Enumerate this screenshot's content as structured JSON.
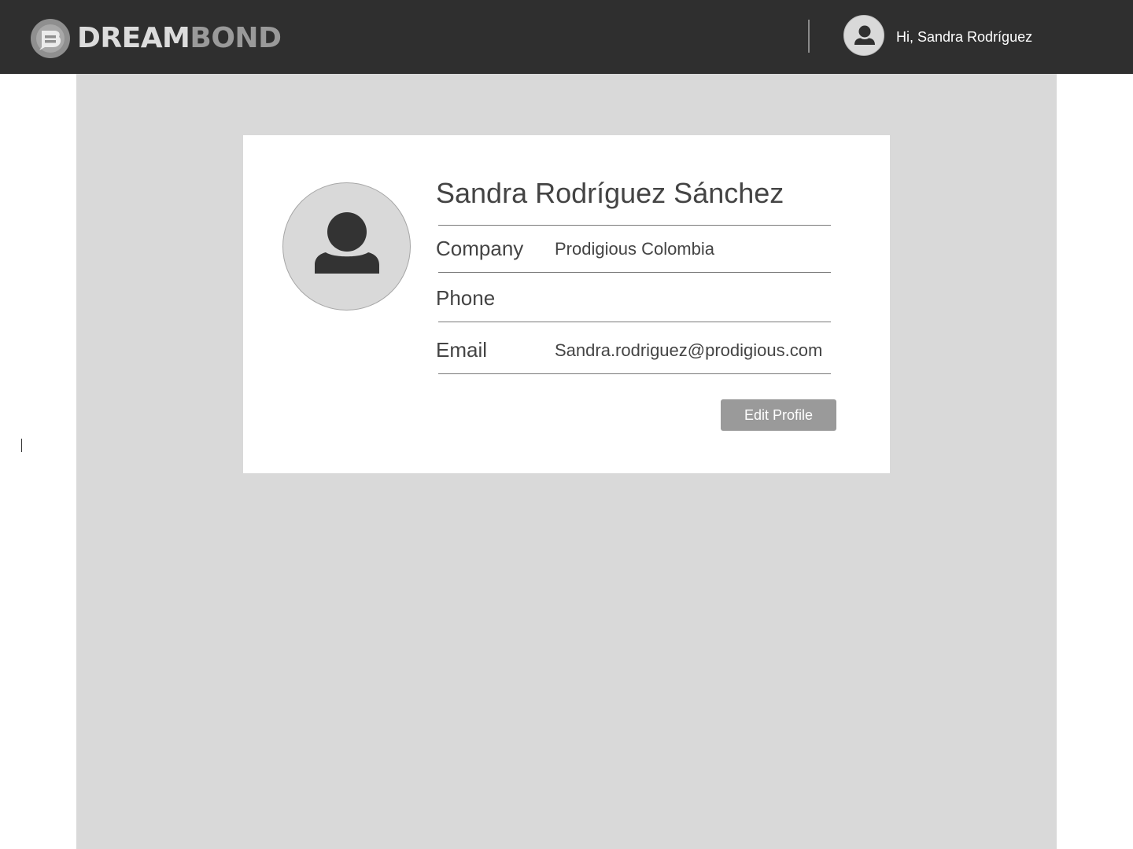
{
  "header": {
    "brand": {
      "name_part_1": "DREAM",
      "name_part_2": "BOND",
      "logo_icon": "dreambond-logo-icon"
    },
    "user_avatar_icon": "user-icon",
    "greeting": "Hi, Sandra Rodríguez"
  },
  "profile": {
    "avatar_icon": "user-icon",
    "full_name": "Sandra Rodríguez Sánchez",
    "fields": {
      "company": {
        "label": "Company",
        "value": "Prodigious Colombia"
      },
      "phone": {
        "label": "Phone",
        "value": ""
      },
      "email": {
        "label": "Email",
        "value": "Sandra.rodriguez@prodigious.com"
      }
    },
    "edit_button_label": "Edit Profile"
  },
  "colors": {
    "header_bg": "#2f2f2f",
    "content_bg": "#d9d9d9",
    "card_bg": "#ffffff",
    "button_bg": "#9a9a9a",
    "text_primary": "#444444"
  }
}
